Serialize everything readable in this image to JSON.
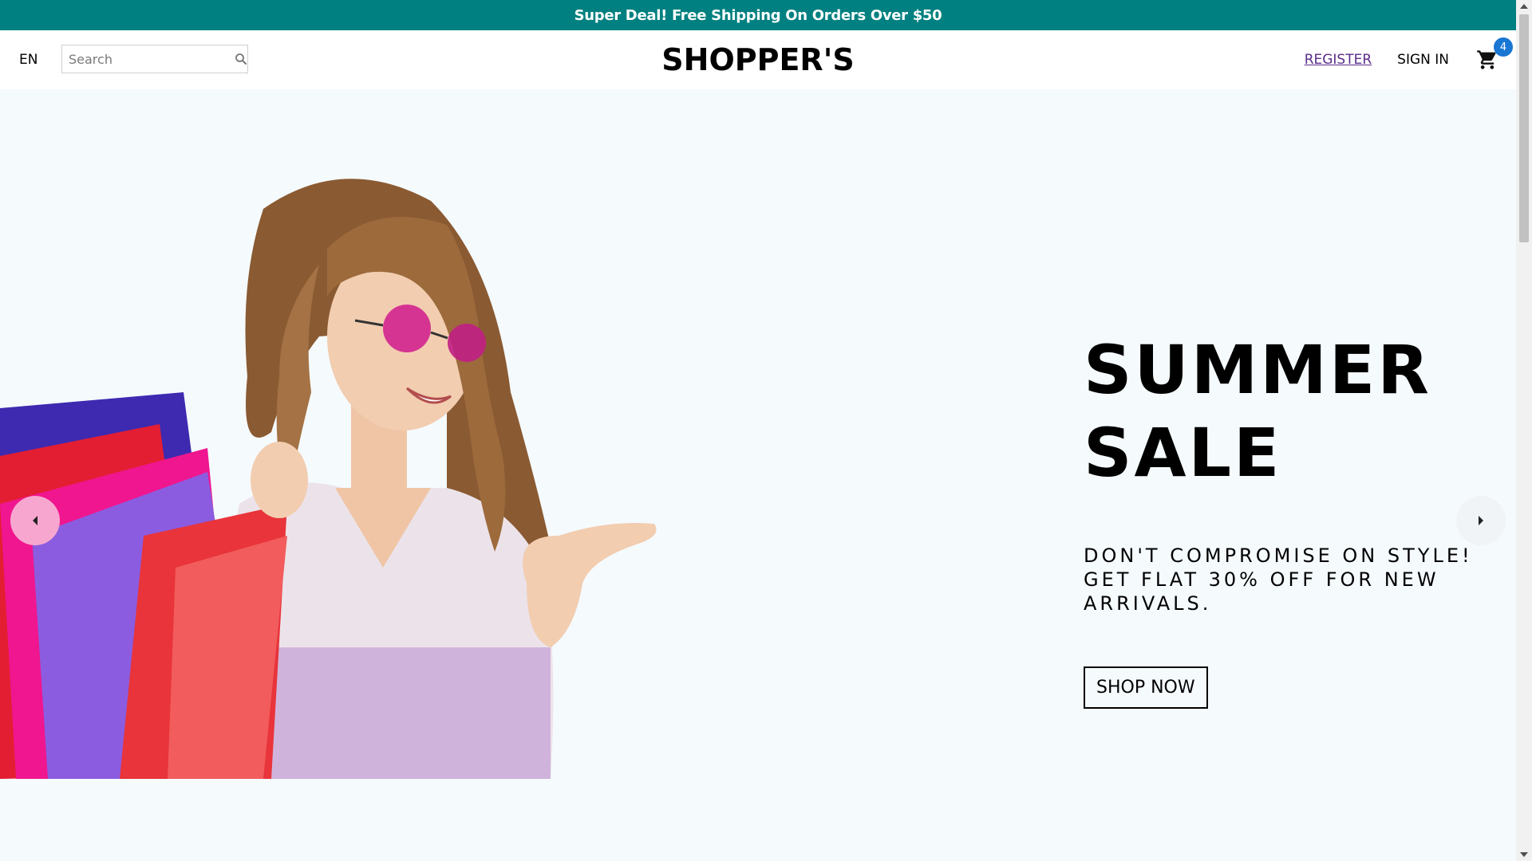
{
  "announcement": {
    "text": "Super Deal! Free Shipping On Orders Over $50"
  },
  "navbar": {
    "language": "EN",
    "search": {
      "placeholder": "Search",
      "value": ""
    },
    "logo": "SHOPPER'S",
    "register": "REGISTER",
    "sign_in": "SIGN IN",
    "cart_count": "4"
  },
  "hero": {
    "title_line1": "SUMMER",
    "title_line2": "SALE",
    "description": "DON'T COMPROMISE ON STYLE! GET FLAT 30% OFF FOR NEW ARRIVALS.",
    "cta": "SHOP NOW",
    "image_desc": "smiling woman with sunglasses holding shopping bags"
  },
  "icons": {
    "search": "search-icon",
    "cart": "cart-icon",
    "arrow_left": "arrow-left-icon",
    "arrow_right": "arrow-right-icon"
  },
  "colors": {
    "announcement_bg": "#008080",
    "hero_bg": "#f5fafd",
    "badge": "#1976d2",
    "arrow_left_bg": "#f7a7cf"
  }
}
